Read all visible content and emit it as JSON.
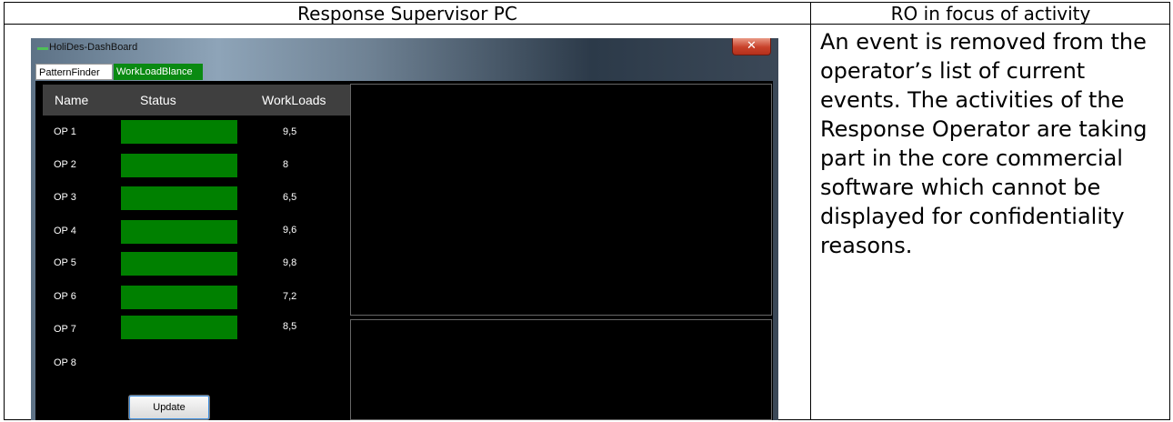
{
  "table": {
    "header_left": "Response Supervisor PC",
    "header_right": "RO in focus of activity",
    "description": "An event is removed from the operator’s list of current events. The activities of the Response Operator are taking part in the core commercial software which cannot be displayed for confidentiality reasons."
  },
  "window": {
    "title": "HoliDes-DashBoard",
    "close_glyph": "✕",
    "tabs": [
      {
        "label": "PatternFinder",
        "active": false
      },
      {
        "label": "WorkLoadBlance",
        "active": true
      }
    ]
  },
  "grid": {
    "headers": {
      "name": "Name",
      "status": "Status",
      "workloads": "WorkLoads"
    },
    "status_color": "#008000",
    "rows": [
      {
        "name": "OP 1",
        "has_status": true,
        "workload": "9,5"
      },
      {
        "name": "OP 2",
        "has_status": true,
        "workload": "8"
      },
      {
        "name": "OP 3",
        "has_status": true,
        "workload": "6,5"
      },
      {
        "name": "OP 4",
        "has_status": true,
        "workload": "9,6"
      },
      {
        "name": "OP 5",
        "has_status": true,
        "workload": "9,8"
      },
      {
        "name": "OP 6",
        "has_status": true,
        "workload": "7,2"
      },
      {
        "name": "OP 7",
        "has_status": true,
        "workload": "8,5"
      },
      {
        "name": "OP 8",
        "has_status": false,
        "workload": ""
      }
    ]
  },
  "buttons": {
    "update": "Update"
  }
}
